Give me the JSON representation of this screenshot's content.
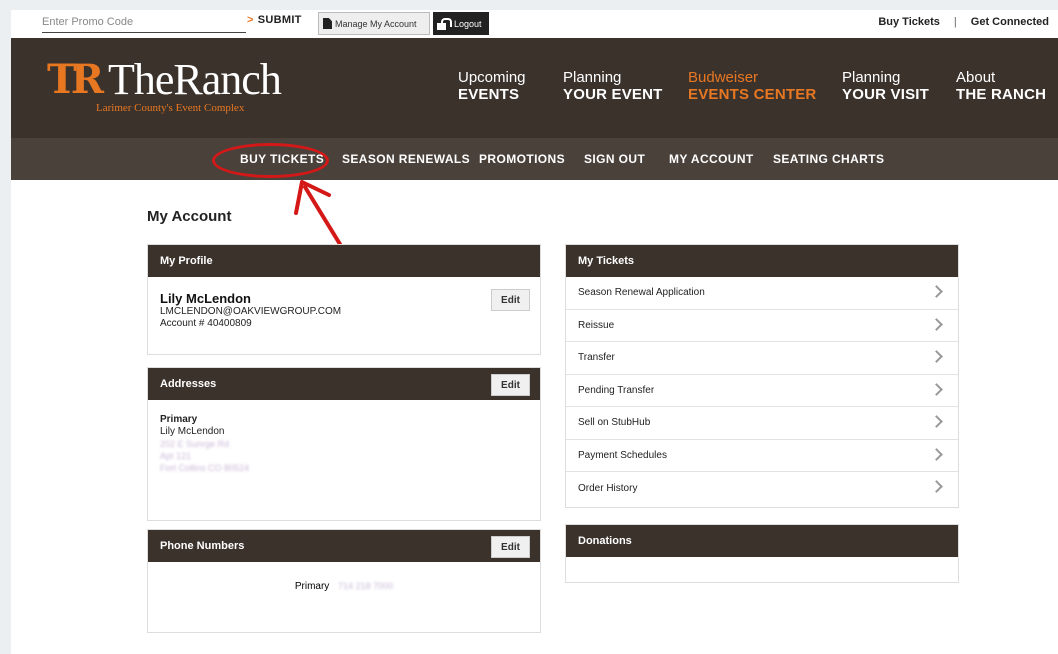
{
  "utility": {
    "promo_placeholder": "Enter Promo Code",
    "submit_label": "SUBMIT",
    "manage_label": "Manage My Account",
    "logout_label": "Logout",
    "buy_tickets": "Buy Tickets",
    "separator": "|",
    "get_connected": "Get Connected"
  },
  "logo": {
    "mark": "TR",
    "name": "TheRanch",
    "tagline": "Larimer County's Event Complex"
  },
  "mainnav": [
    {
      "line1": "Upcoming",
      "line2": "EVENTS"
    },
    {
      "line1": "Planning",
      "line2": "YOUR EVENT"
    },
    {
      "line1": "Budweiser",
      "line2": "EVENTS CENTER"
    },
    {
      "line1": "Planning",
      "line2": "YOUR VISIT"
    },
    {
      "line1": "About",
      "line2": "THE RANCH"
    }
  ],
  "subnav": [
    "BUY TICKETS",
    "SEASON RENEWALS",
    "PROMOTIONS",
    "SIGN OUT",
    "MY ACCOUNT",
    "SEATING CHARTS"
  ],
  "page_title": "My Account",
  "profile": {
    "heading": "My Profile",
    "name": "Lily McLendon",
    "email": "LMCLENDON@OAKVIEWGROUP.COM",
    "account": "Account # 40400809",
    "edit": "Edit"
  },
  "addresses": {
    "heading": "Addresses",
    "edit": "Edit",
    "type": "Primary",
    "name": "Lily McLendon",
    "line1": "202 E Sunrge Rd",
    "line2": "Apt 121",
    "line3": "Fort Collins CO 80524"
  },
  "phones": {
    "heading": "Phone Numbers",
    "edit": "Edit",
    "label": "Primary",
    "number": "714 218 7000"
  },
  "tickets": {
    "heading": "My Tickets",
    "items": [
      "Season Renewal Application",
      "Reissue",
      "Transfer",
      "Pending Transfer",
      "Sell on StubHub",
      "Payment Schedules",
      "Order History"
    ]
  },
  "donations": {
    "heading": "Donations"
  },
  "colors": {
    "header_bg": "#3b322c",
    "subnav_bg": "#4a413b",
    "accent": "#e87722",
    "annotation": "#d41818"
  }
}
